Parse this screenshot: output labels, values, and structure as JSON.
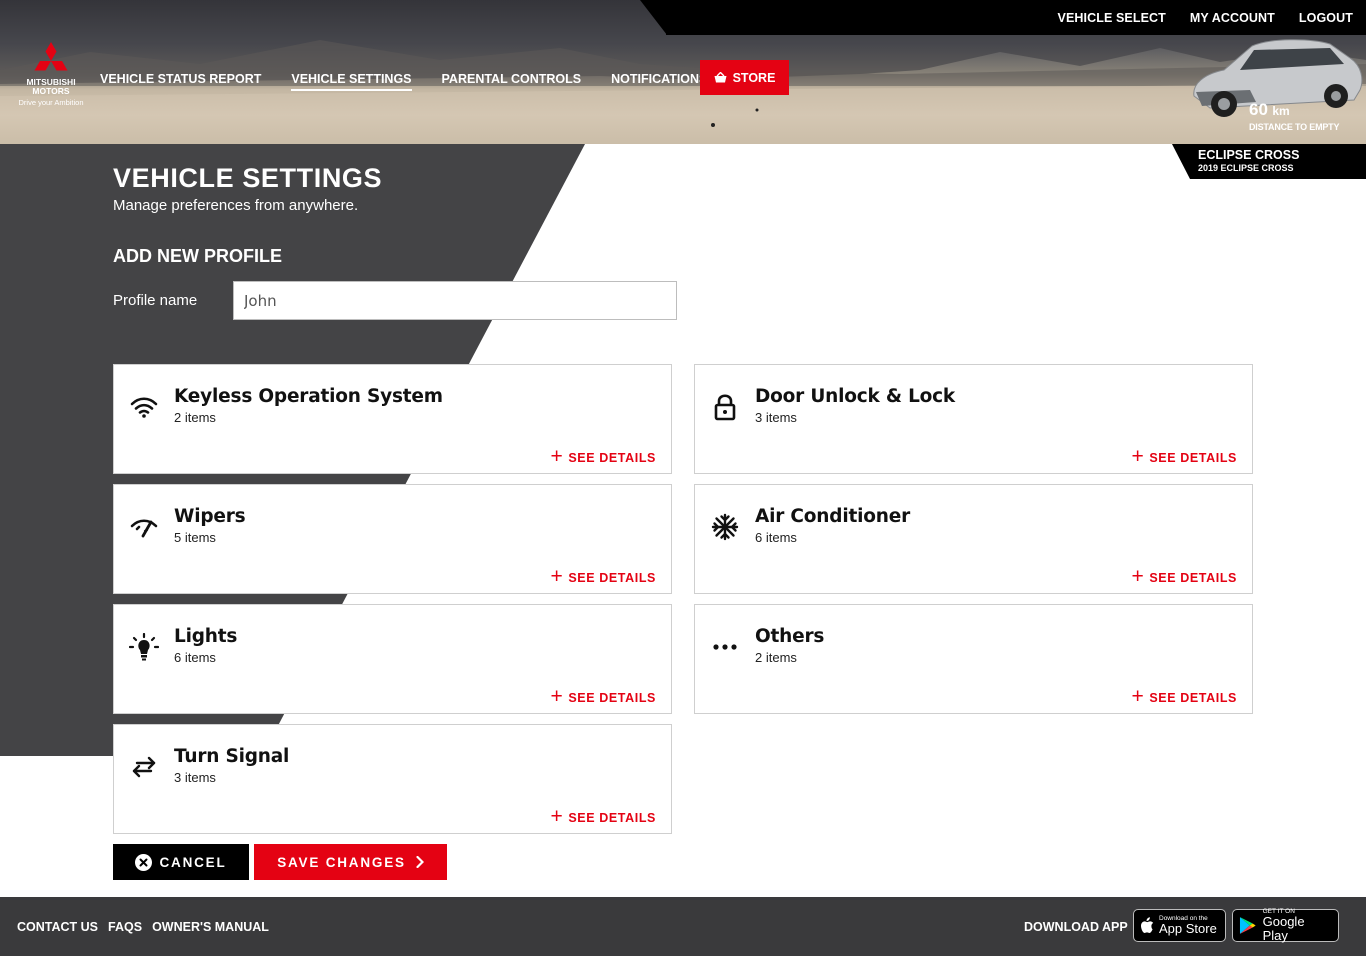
{
  "brand": {
    "name": "MITSUBISHI MOTORS",
    "tagline": "Drive your Ambition"
  },
  "topbar": [
    "VEHICLE SELECT",
    "MY ACCOUNT",
    "LOGOUT"
  ],
  "nav": {
    "items": [
      "VEHICLE STATUS REPORT",
      "VEHICLE SETTINGS",
      "PARENTAL CONTROLS",
      "NOTIFICATIONS"
    ],
    "active": "VEHICLE SETTINGS",
    "store_label": "STORE"
  },
  "vehicle": {
    "distance_value": "60",
    "distance_unit": "km",
    "distance_label": "DISTANCE TO EMPTY",
    "model": "ECLIPSE CROSS",
    "model_sub": "2019 ECLIPSE CROSS"
  },
  "page": {
    "title": "VEHICLE SETTINGS",
    "subtitle": "Manage preferences from anywhere.",
    "section_title": "ADD NEW PROFILE",
    "profile_label": "Profile name",
    "profile_value": "John"
  },
  "see_details_label": "SEE DETAILS",
  "cards": [
    {
      "title": "Keyless Operation System",
      "count": "2 items",
      "icon": "wifi-icon"
    },
    {
      "title": "Door Unlock & Lock",
      "count": "3 items",
      "icon": "lock-icon"
    },
    {
      "title": "Wipers",
      "count": "5 items",
      "icon": "wiper-icon"
    },
    {
      "title": "Air Conditioner",
      "count": "6 items",
      "icon": "snowflake-icon"
    },
    {
      "title": "Lights",
      "count": "6 items",
      "icon": "lightbulb-icon"
    },
    {
      "title": "Others",
      "count": "2 items",
      "icon": "more-icon"
    },
    {
      "title": "Turn Signal",
      "count": "3 items",
      "icon": "turn-signal-icon"
    }
  ],
  "actions": {
    "cancel": "CANCEL",
    "save": "SAVE CHANGES"
  },
  "footer": {
    "links": [
      "CONTACT US",
      "FAQS",
      "OWNER'S MANUAL"
    ],
    "download_label": "DOWNLOAD APP",
    "app_store_small": "Download on the",
    "app_store_big": "App Store",
    "google_small": "GET IT ON",
    "google_big": "Google Play"
  },
  "colors": {
    "accent": "#e40213",
    "dark": "#444446",
    "footer": "#3a3a3c"
  }
}
